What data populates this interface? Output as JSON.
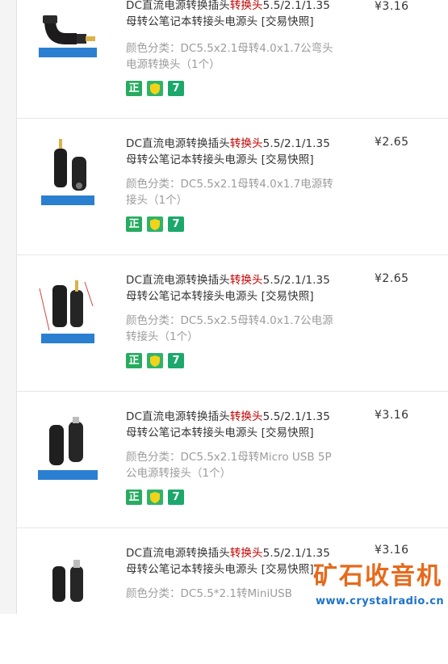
{
  "items": [
    {
      "title_pre": "DC直流电源转换插头",
      "title_hl": "转换头",
      "title_mid": "5.5/2.1/1.35",
      "title_line2": "母转公笔记本转接头电源头 [交易快照]",
      "sku_line1": "颜色分类：DC5.5x2.1母转4.0x1.7公弯头",
      "sku_line2": "电源转换头（1个）",
      "price": "¥3.16",
      "badge_zheng": "正",
      "badge_seven": "7",
      "img_caption": "DC5.5x2.1母转4.0x1.7公弯头电源转换头"
    },
    {
      "title_pre": "DC直流电源转换插头",
      "title_hl": "转换头",
      "title_mid": "5.5/2.1/1.35",
      "title_line2": "母转公笔记本转接头电源头 [交易快照]",
      "sku_line1": "颜色分类：DC5.5x2.1母转4.0x1.7电源转",
      "sku_line2": "接头（1个）",
      "price": "¥2.65",
      "badge_zheng": "正",
      "badge_seven": "7",
      "img_caption": "DC5.5x2.1母转4.0x1.7公电源转接头"
    },
    {
      "title_pre": "DC直流电源转换插头",
      "title_hl": "转换头",
      "title_mid": "5.5/2.1/1.35",
      "title_line2": "母转公笔记本转接头电源头 [交易快照]",
      "sku_line1": "颜色分类：DC5.5x2.5母转4.0x1.7公电源",
      "sku_line2": "转接头（1个）",
      "price": "¥2.65",
      "badge_zheng": "正",
      "badge_seven": "7",
      "img_caption": "DC5.5x2.5母转4.0x1.7公电源转接头"
    },
    {
      "title_pre": "DC直流电源转换插头",
      "title_hl": "转换头",
      "title_mid": "5.5/2.1/1.35",
      "title_line2": "母转公笔记本转接头电源头 [交易快照]",
      "sku_line1": "颜色分类：DC5.5x2.1母转Micro USB 5P",
      "sku_line2": "公电源转接头（1个）",
      "price": "¥3.16",
      "badge_zheng": "正",
      "badge_seven": "7",
      "img_caption": "Micro USB 5P公电源转接头"
    },
    {
      "title_pre": "DC直流电源转换插头",
      "title_hl": "转换头",
      "title_mid": "5.5/2.1/1.35",
      "title_line2": "母转公笔记本转接头电源头 [交易快照]",
      "sku_line1": "颜色分类：DC5.5*2.1转MiniUSB",
      "sku_line2": "",
      "price": "¥3.16",
      "badge_zheng": "正",
      "badge_seven": "7",
      "img_caption": ""
    }
  ],
  "watermark": {
    "cn": "矿石收音机",
    "url": "www.crystalradio.cn"
  },
  "colors": {
    "highlight": "#c40000",
    "sku_text": "#9c9c9c",
    "badge_green": "#27ab60",
    "watermark_orange": "#e66a1c",
    "watermark_blue": "#1f72c8"
  }
}
